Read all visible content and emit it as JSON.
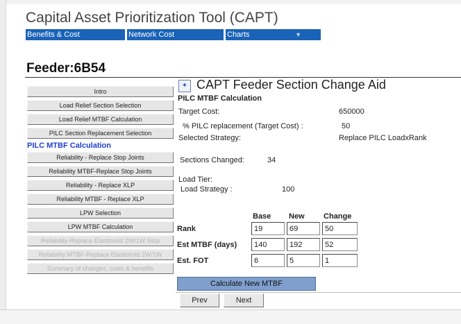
{
  "app": {
    "title": "Capital Asset Prioritization Tool (CAPT)"
  },
  "nav": {
    "tabs": [
      {
        "label": "Benefits & Cost"
      },
      {
        "label": "Network Cost"
      },
      {
        "label": "Charts"
      }
    ],
    "dropdown_icon": "dropdown-arrow-icon"
  },
  "feeder": {
    "title": "Feeder:6B54"
  },
  "sidebar": {
    "items": [
      {
        "label": "Intro"
      },
      {
        "label": "Load Relief Section Selection"
      },
      {
        "label": "Load Relief MTBF Calculation"
      },
      {
        "label": "PILC Section Replacement Selection"
      },
      {
        "label": "PILC MTBF Calculation"
      },
      {
        "label": "Reliability - Replace Stop Joints"
      },
      {
        "label": "Reliability MTBF-Replace Stop Joints"
      },
      {
        "label": "Reliability - Replace XLP"
      },
      {
        "label": "Reliability MTBF - Replace XLP"
      },
      {
        "label": "LPW Selection"
      },
      {
        "label": "LPW MTBF Calculation"
      },
      {
        "label": "Reliability-Replace Elastimold 2W/1W Stop"
      },
      {
        "label": "Reliability MTBF-Replace Elastimold 2W/1W"
      },
      {
        "label": "Summary of changes, costs & benefits"
      }
    ]
  },
  "aid": {
    "title": "CAPT Feeder Section Change Aid",
    "icon": "aid-window-icon",
    "section_title": "PILC MTBF Calculation",
    "target_cost_label": "Target Cost:",
    "target_cost_value": "650000",
    "pilc_label": "% PILC replacement (Target Cost) :",
    "pilc_value": "50",
    "strategy_label": "Selected Strategy:",
    "strategy_value": "Replace PILC LoadxRank",
    "sections_changed_label": "Sections Changed:",
    "sections_changed_value": "34",
    "load_tier_label": "Load Tier:",
    "load_strategy_label": "Load Strategy :",
    "load_strategy_value": "100"
  },
  "table": {
    "headers": [
      "Base",
      "New",
      "Change"
    ],
    "rows": [
      {
        "label": "Rank",
        "base": "19",
        "new": "69",
        "change": "50"
      },
      {
        "label": "Est MTBF (days)",
        "base": "140",
        "new": "192",
        "change": "52"
      },
      {
        "label": "Est. FOT",
        "base": "6",
        "new": "5",
        "change": "1"
      }
    ]
  },
  "actions": {
    "calculate_label": "Calculate New MTBF",
    "prev_label": "Prev",
    "next_label": "Next"
  },
  "colors": {
    "nav_tab_bg": "#1a63b8",
    "active_item_text": "#1f3fd0",
    "calculate_button_bg": "#7f9fcd",
    "disabled_text": "#b4b4b4"
  }
}
